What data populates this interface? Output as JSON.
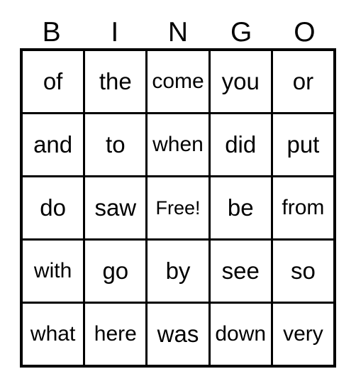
{
  "card": {
    "title": "BINGO",
    "colors": {
      "background": "#ffffff",
      "line": "#000000",
      "text": "#000000"
    },
    "header": {
      "letters": [
        "B",
        "I",
        "N",
        "G",
        "O"
      ]
    },
    "grid": {
      "columns": 5,
      "rows": 5,
      "free_space_label": "Free!",
      "free_space_position": {
        "row": 2,
        "col": 2
      },
      "cells": [
        [
          "of",
          "the",
          "come",
          "you",
          "or"
        ],
        [
          "and",
          "to",
          "when",
          "did",
          "put"
        ],
        [
          "do",
          "saw",
          "Free!",
          "be",
          "from"
        ],
        [
          "with",
          "go",
          "by",
          "see",
          "so"
        ],
        [
          "what",
          "here",
          "was",
          "down",
          "very"
        ]
      ]
    }
  }
}
